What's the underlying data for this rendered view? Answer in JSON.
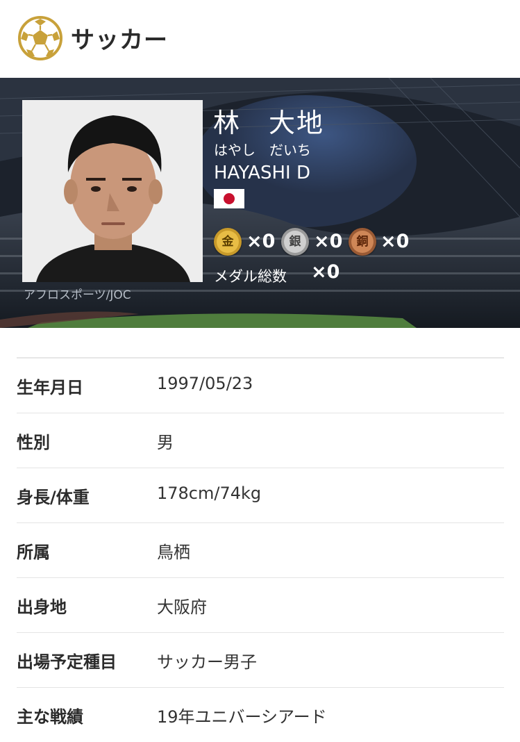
{
  "header": {
    "sport": "サッカー",
    "icon": "soccer-ball-icon",
    "accent": "#c8a13a"
  },
  "athlete": {
    "name_kanji": "林　大地",
    "name_kana": "はやし　だいち",
    "name_roman": "HAYASHI D",
    "photo_credit": "アフロスポーツ/JOC",
    "country_flag": "japan-flag-icon"
  },
  "medals": {
    "gold": {
      "label": "金",
      "count": "×0",
      "color": "#e8bd45"
    },
    "silver": {
      "label": "銀",
      "count": "×0",
      "color": "#cfcfcf"
    },
    "bronze": {
      "label": "銅",
      "count": "×0",
      "color": "#cf8757"
    },
    "total_label": "メダル総数",
    "total_count": "×0"
  },
  "profile": [
    {
      "label": "生年月日",
      "value": "1997/05/23"
    },
    {
      "label": "性別",
      "value": "男"
    },
    {
      "label": "身長/体重",
      "value": "178cm/74kg"
    },
    {
      "label": "所属",
      "value": "鳥栖"
    },
    {
      "label": "出身地",
      "value": "大阪府"
    },
    {
      "label": "出場予定種目",
      "value": "サッカー男子"
    },
    {
      "label": "主な戦績",
      "value": "19年ユニバーシアード"
    }
  ]
}
